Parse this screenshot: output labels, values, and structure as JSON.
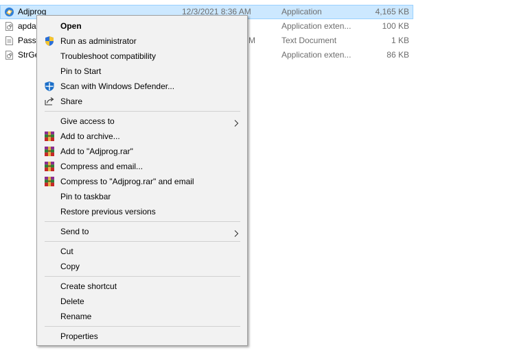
{
  "files": [
    {
      "name": "Adjprog",
      "date": "12/3/2021 8:36 AM",
      "type": "Application",
      "size": "4,165 KB",
      "icon": "app-icon",
      "selected": true
    },
    {
      "name": "apda",
      "date": "",
      "type": "Application exten...",
      "size": "100 KB",
      "icon": "dll-icon"
    },
    {
      "name": "Passv",
      "date": "M",
      "type": "Text Document",
      "size": "1 KB",
      "icon": "text-file-icon"
    },
    {
      "name": "StrGe",
      "date": "",
      "type": "Application exten...",
      "size": "86 KB",
      "icon": "dll-icon"
    }
  ],
  "menu": {
    "open": "Open",
    "run_admin": "Run as administrator",
    "troubleshoot": "Troubleshoot compatibility",
    "pin_start": "Pin to Start",
    "scan_defender": "Scan with Windows Defender...",
    "share": "Share",
    "give_access": "Give access to",
    "add_archive": "Add to archive...",
    "add_rar": "Add to \"Adjprog.rar\"",
    "compress_email": "Compress and email...",
    "compress_rar_email": "Compress to \"Adjprog.rar\" and email",
    "pin_taskbar": "Pin to taskbar",
    "restore_versions": "Restore previous versions",
    "send_to": "Send to",
    "cut": "Cut",
    "copy": "Copy",
    "create_shortcut": "Create shortcut",
    "delete": "Delete",
    "rename": "Rename",
    "properties": "Properties"
  }
}
